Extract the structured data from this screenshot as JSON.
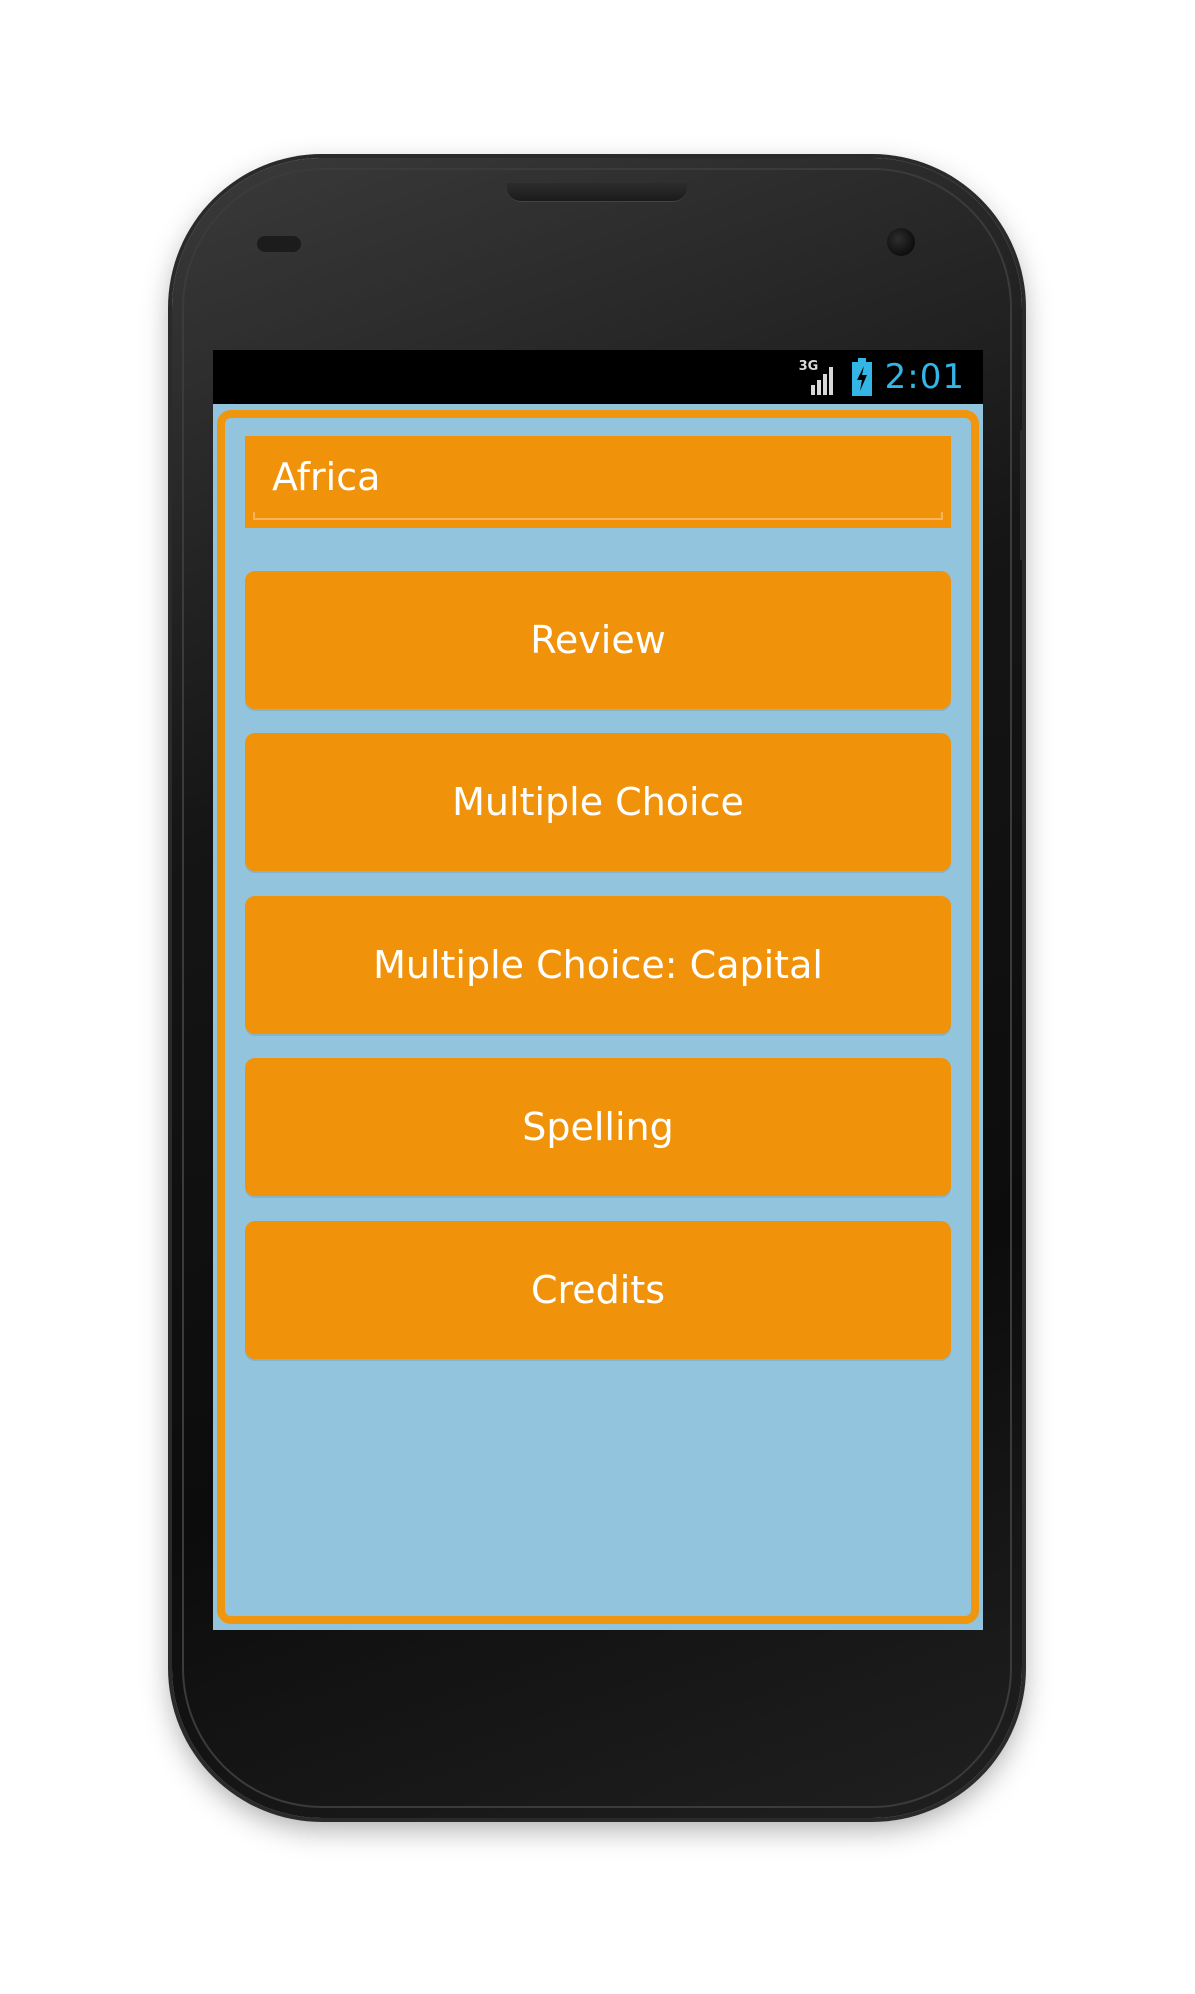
{
  "status_bar": {
    "network_type": "3G",
    "signal_icon": "signal-bars-icon",
    "battery_icon": "battery-charging-icon",
    "time": "2:01",
    "time_color": "#33b5e5"
  },
  "app": {
    "frame_color": "#f0950e",
    "background_color": "#92c5dd",
    "title_field": {
      "value": "Africa"
    },
    "menu_buttons": [
      {
        "label": "Review"
      },
      {
        "label": "Multiple Choice"
      },
      {
        "label": "Multiple Choice: Capital"
      },
      {
        "label": "Spelling"
      },
      {
        "label": "Credits"
      }
    ],
    "button_color": "#f0920a"
  }
}
